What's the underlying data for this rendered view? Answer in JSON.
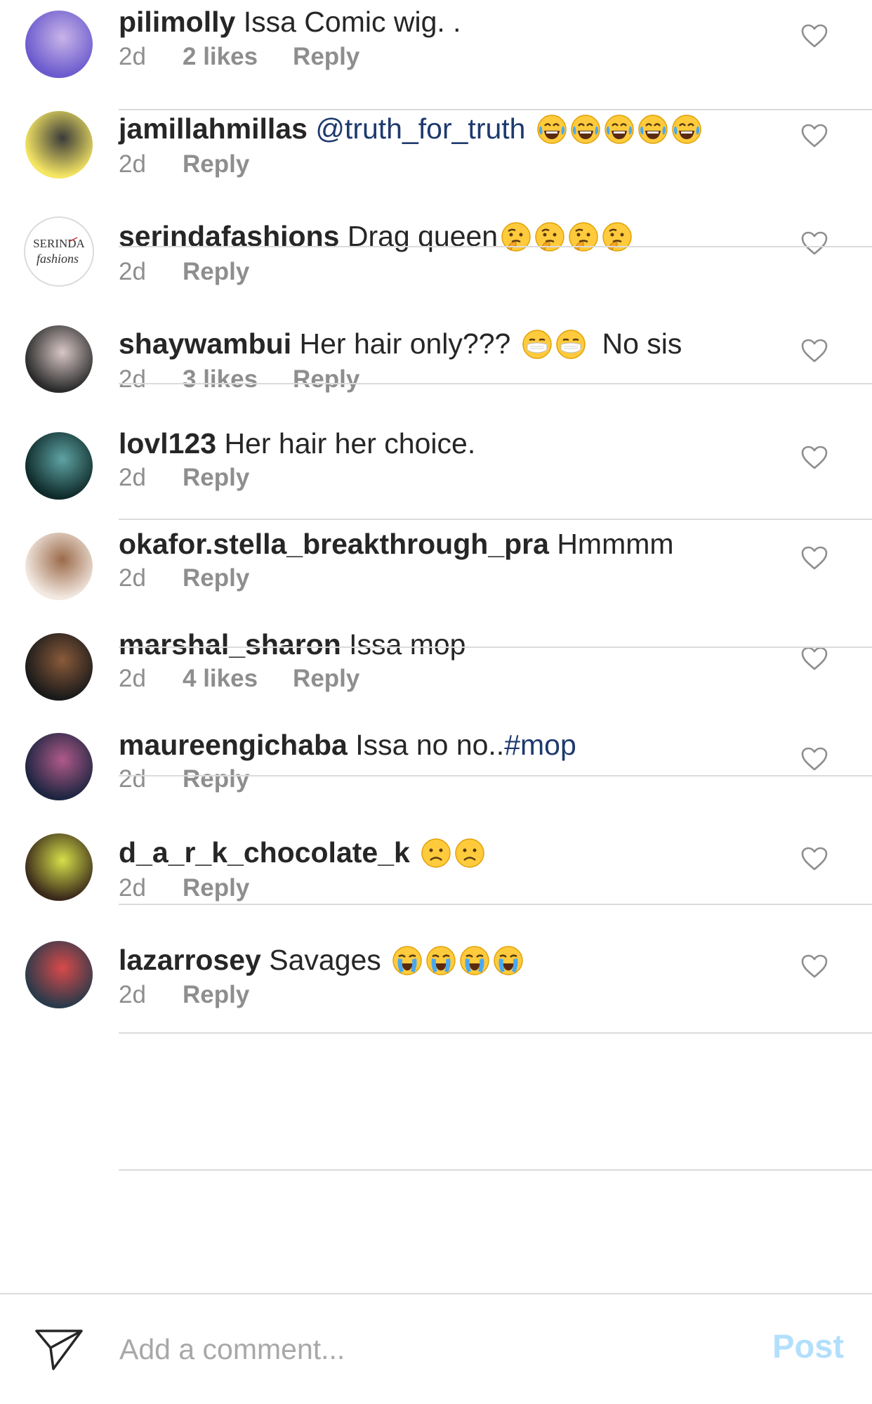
{
  "comments": [
    {
      "username": "pilimolly",
      "parts": [
        {
          "type": "text",
          "value": " Issa Comic wig. ."
        }
      ],
      "time": "2d",
      "likes": "2 likes",
      "reply": "Reply",
      "avatar_colors": [
        "#6a5acd",
        "#c8b4e8"
      ]
    },
    {
      "username": "jamillahmillas",
      "parts": [
        {
          "type": "text",
          "value": " "
        },
        {
          "type": "mention",
          "value": "@truth_for_truth"
        },
        {
          "type": "text",
          "value": " "
        },
        {
          "type": "emoji",
          "value": "laugh"
        },
        {
          "type": "emoji",
          "value": "laugh"
        },
        {
          "type": "emoji",
          "value": "laugh"
        },
        {
          "type": "emoji",
          "value": "laugh"
        },
        {
          "type": "emoji",
          "value": "laugh"
        }
      ],
      "time": "2d",
      "likes": "",
      "reply": "Reply",
      "avatar_colors": [
        "#f5e663",
        "#3a3a3a"
      ]
    },
    {
      "username": "serindafashions",
      "parts": [
        {
          "type": "text",
          "value": " Drag queen"
        },
        {
          "type": "emoji",
          "value": "thinking"
        },
        {
          "type": "emoji",
          "value": "thinking"
        },
        {
          "type": "emoji",
          "value": "thinking"
        },
        {
          "type": "emoji",
          "value": "thinking"
        }
      ],
      "time": "2d",
      "likes": "",
      "reply": "Reply",
      "avatar_logo": [
        "SERINDA",
        "fashions"
      ]
    },
    {
      "username": "shaywambui",
      "parts": [
        {
          "type": "text",
          "value": " Her hair only??? "
        },
        {
          "type": "emoji",
          "value": "mask"
        },
        {
          "type": "emoji",
          "value": "mask"
        },
        {
          "type": "text",
          "value": "  No sis"
        }
      ],
      "time": "2d",
      "likes": "3 likes",
      "reply": "Reply",
      "avatar_colors": [
        "#2b2b2b",
        "#d9c7c7"
      ]
    },
    {
      "username": "lovl123",
      "parts": [
        {
          "type": "text",
          "value": " Her hair her choice."
        }
      ],
      "time": "2d",
      "likes": "",
      "reply": "Reply",
      "avatar_colors": [
        "#0f2a2a",
        "#5fa3a3"
      ]
    },
    {
      "username": "okafor.stella_breakthrough_pra",
      "parts": [
        {
          "type": "text",
          "value": " Hmmmm"
        }
      ],
      "time": "2d",
      "likes": "",
      "reply": "Reply",
      "avatar_colors": [
        "#f3e9e1",
        "#9b6a4a"
      ]
    },
    {
      "username": "marshal_sharon",
      "parts": [
        {
          "type": "text",
          "value": " Issa mop"
        }
      ],
      "time": "2d",
      "likes": "4 likes",
      "reply": "Reply",
      "avatar_colors": [
        "#1a1a1a",
        "#8a5a3a"
      ]
    },
    {
      "username": "maureengichaba",
      "parts": [
        {
          "type": "text",
          "value": " Issa no no.."
        },
        {
          "type": "hashtag",
          "value": "#mop"
        }
      ],
      "time": "2d",
      "likes": "",
      "reply": "Reply",
      "avatar_colors": [
        "#1d2540",
        "#b05a8a"
      ]
    },
    {
      "username": "d_a_r_k_chocolate_k",
      "parts": [
        {
          "type": "text",
          "value": " "
        },
        {
          "type": "emoji",
          "value": "frown"
        },
        {
          "type": "emoji",
          "value": "frown"
        }
      ],
      "time": "2d",
      "likes": "",
      "reply": "Reply",
      "avatar_colors": [
        "#3a2a1a",
        "#d6e04a"
      ]
    },
    {
      "username": "lazarrosey",
      "parts": [
        {
          "type": "text",
          "value": " Savages "
        },
        {
          "type": "emoji",
          "value": "cry"
        },
        {
          "type": "emoji",
          "value": "cry"
        },
        {
          "type": "emoji",
          "value": "cry"
        },
        {
          "type": "emoji",
          "value": "cry"
        }
      ],
      "time": "2d",
      "likes": "",
      "reply": "Reply",
      "avatar_colors": [
        "#2a3a4a",
        "#d84a4a"
      ]
    }
  ],
  "composer": {
    "placeholder": "Add a comment...",
    "post_label": "Post",
    "post_color": "#b2dffc"
  },
  "icons": {
    "like": "heart-outline-icon",
    "send": "paper-plane-icon"
  }
}
